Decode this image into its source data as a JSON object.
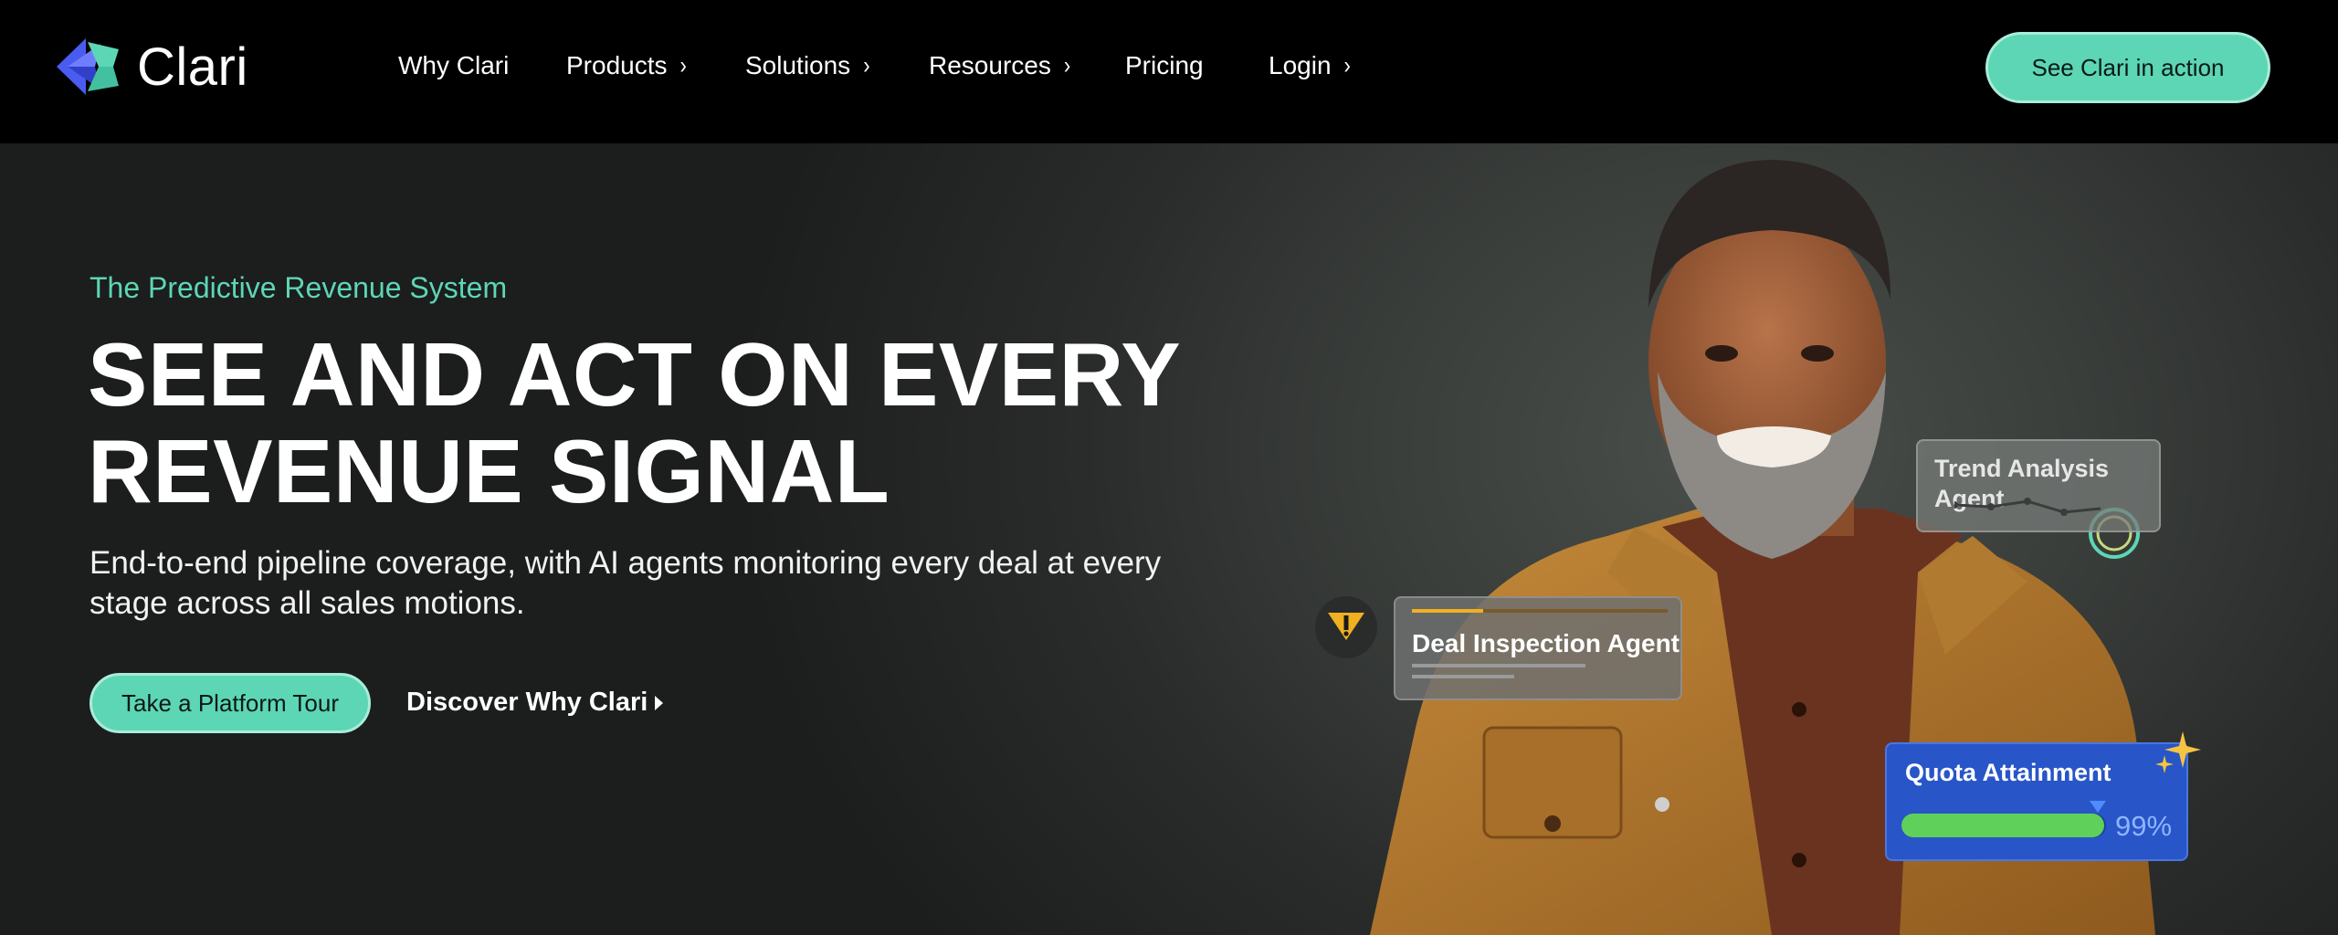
{
  "brand": {
    "name": "Clari",
    "accent": "#5dd6b5"
  },
  "nav": {
    "items": [
      {
        "label": "Why Clari",
        "has_chevron": false
      },
      {
        "label": "Products",
        "has_chevron": true
      },
      {
        "label": "Solutions",
        "has_chevron": true
      },
      {
        "label": "Resources",
        "has_chevron": true
      },
      {
        "label": "Pricing",
        "has_chevron": false
      },
      {
        "label": "Login",
        "has_chevron": true
      }
    ],
    "chevron_glyph": "›",
    "cta_label": "See Clari in action"
  },
  "hero": {
    "eyebrow": "The Predictive Revenue System",
    "headline_line1": "SEE AND ACT ON EVERY",
    "headline_line2": "REVENUE SIGNAL",
    "subtitle": "End-to-end pipeline coverage, with AI agents monitoring every deal at every stage across all sales motions.",
    "primary_cta": "Take a Platform Tour",
    "secondary_link": "Discover Why Clari"
  },
  "cards": {
    "trend": {
      "line1": "Trend Analysis",
      "line2": "Agent",
      "icon": "trend-ring-icon"
    },
    "deal": {
      "title": "Deal Inspection Agent",
      "icon": "warning-icon"
    },
    "quota": {
      "title": "Quota Attainment",
      "percent_text": "99%",
      "progress": 0.99,
      "icon": "sparkle-icon"
    }
  }
}
